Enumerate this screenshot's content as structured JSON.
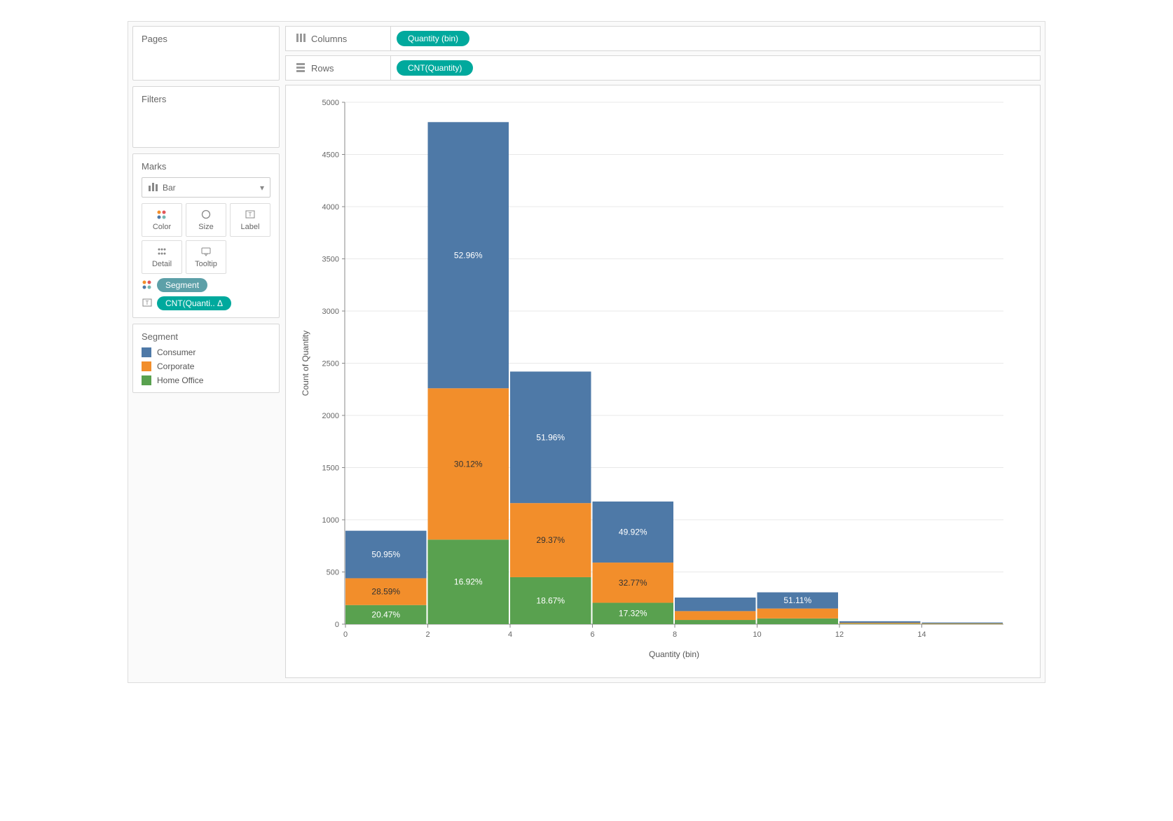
{
  "sidebar": {
    "pages_label": "Pages",
    "filters_label": "Filters",
    "marks_label": "Marks",
    "mark_type": "Bar",
    "buttons": {
      "color": "Color",
      "size": "Size",
      "label": "Label",
      "detail": "Detail",
      "tooltip": "Tooltip"
    },
    "encodings": {
      "color_pill": "Segment",
      "label_pill": "CNT(Quanti.. Δ"
    },
    "legend_title": "Segment",
    "legend_items": [
      {
        "label": "Consumer",
        "color": "#4e79a7"
      },
      {
        "label": "Corporate",
        "color": "#f28e2b"
      },
      {
        "label": "Home Office",
        "color": "#59a14f"
      }
    ]
  },
  "shelves": {
    "columns_label": "Columns",
    "columns_pill": "Quantity (bin)",
    "rows_label": "Rows",
    "rows_pill": "CNT(Quantity)"
  },
  "chart_data": {
    "type": "bar",
    "stacked": true,
    "xlabel": "Quantity (bin)",
    "ylabel": "Count of Quantity",
    "ylim": [
      0,
      5000
    ],
    "yticks": [
      0,
      500,
      1000,
      1500,
      2000,
      2500,
      3000,
      3500,
      4000,
      4500,
      5000
    ],
    "xticks": [
      0,
      2,
      4,
      6,
      8,
      10,
      12,
      14
    ],
    "bins": [
      0,
      2,
      4,
      6,
      8,
      10,
      12,
      14
    ],
    "series": [
      {
        "name": "Consumer",
        "color": "#4e79a7",
        "values": [
          455,
          2550,
          1260,
          585,
          130,
          155,
          15,
          8
        ]
      },
      {
        "name": "Corporate",
        "color": "#f28e2b",
        "values": [
          257,
          1450,
          710,
          385,
          85,
          95,
          8,
          5
        ]
      },
      {
        "name": "Home Office",
        "color": "#59a14f",
        "values": [
          183,
          810,
          450,
          205,
          40,
          55,
          5,
          3
        ]
      }
    ],
    "labels": [
      {
        "bin": 0,
        "seg": "Consumer",
        "text": "50.95%"
      },
      {
        "bin": 0,
        "seg": "Corporate",
        "text": "28.59%"
      },
      {
        "bin": 0,
        "seg": "Home Office",
        "text": "20.47%"
      },
      {
        "bin": 2,
        "seg": "Consumer",
        "text": "52.96%"
      },
      {
        "bin": 2,
        "seg": "Corporate",
        "text": "30.12%"
      },
      {
        "bin": 2,
        "seg": "Home Office",
        "text": "16.92%"
      },
      {
        "bin": 4,
        "seg": "Consumer",
        "text": "51.96%"
      },
      {
        "bin": 4,
        "seg": "Corporate",
        "text": "29.37%"
      },
      {
        "bin": 4,
        "seg": "Home Office",
        "text": "18.67%"
      },
      {
        "bin": 6,
        "seg": "Consumer",
        "text": "49.92%"
      },
      {
        "bin": 6,
        "seg": "Corporate",
        "text": "32.77%"
      },
      {
        "bin": 6,
        "seg": "Home Office",
        "text": "17.32%"
      },
      {
        "bin": 10,
        "seg": "Consumer",
        "text": "51.11%"
      }
    ]
  }
}
